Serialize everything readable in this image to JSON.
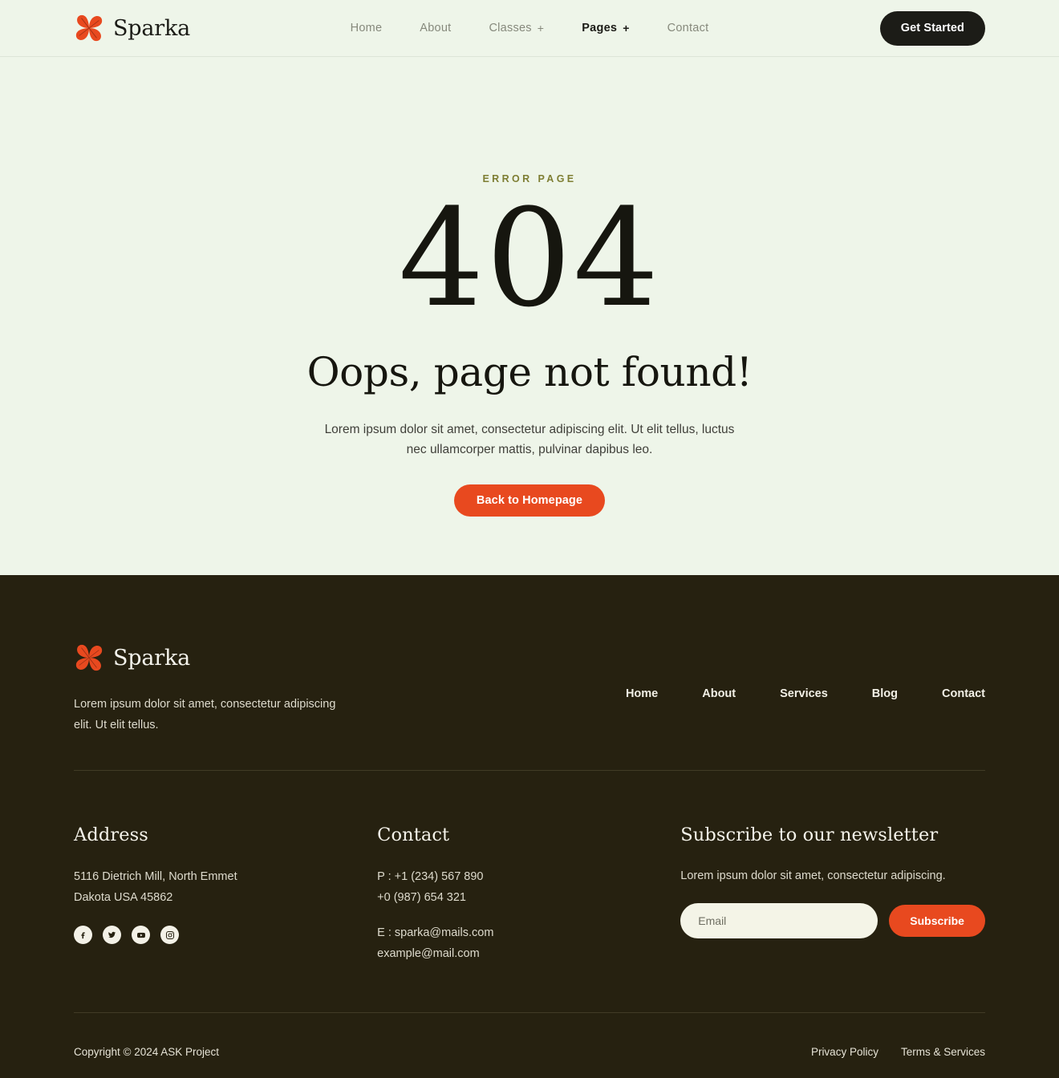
{
  "brand": {
    "name": "Sparka",
    "logo_icon": "four-petal-flower-icon",
    "accent_color": "#e8491f",
    "dark_color": "#262110",
    "hero_bg_color": "#eef5e9",
    "eyebrow_color": "#7e7e33"
  },
  "header": {
    "nav": [
      {
        "label": "Home",
        "has_dropdown": false,
        "active": false
      },
      {
        "label": "About",
        "has_dropdown": false,
        "active": false
      },
      {
        "label": "Classes",
        "has_dropdown": true,
        "plus": "+",
        "active": false
      },
      {
        "label": "Pages",
        "has_dropdown": true,
        "plus": "+",
        "active": true
      },
      {
        "label": "Contact",
        "has_dropdown": false,
        "active": false
      }
    ],
    "cta_label": "Get Started"
  },
  "hero": {
    "eyebrow": "ERROR PAGE",
    "code": "404",
    "title": "Oops, page not found!",
    "description": "Lorem ipsum dolor sit amet, consectetur adipiscing elit. Ut elit tellus, luctus nec ullamcorper mattis, pulvinar dapibus leo.",
    "button_label": "Back to Homepage"
  },
  "footer": {
    "about_text": "Lorem ipsum dolor sit amet, consectetur adipiscing elit. Ut elit tellus.",
    "nav": [
      {
        "label": "Home"
      },
      {
        "label": "About"
      },
      {
        "label": "Services"
      },
      {
        "label": "Blog"
      },
      {
        "label": "Contact"
      }
    ],
    "address": {
      "title": "Address",
      "line1": "5116 Dietrich Mill, North Emmet",
      "line2": "Dakota USA 45862"
    },
    "socials": [
      {
        "name": "facebook-icon",
        "label": "Facebook"
      },
      {
        "name": "twitter-icon",
        "label": "Twitter"
      },
      {
        "name": "youtube-icon",
        "label": "YouTube"
      },
      {
        "name": "instagram-icon",
        "label": "Instagram"
      }
    ],
    "contact": {
      "title": "Contact",
      "phone1": "P : +1 (234) 567 890",
      "phone2": "+0 (987) 654 321",
      "email1": "E : sparka@mails.com",
      "email2": "example@mail.com"
    },
    "newsletter": {
      "title": "Subscribe to our newsletter",
      "text": "Lorem ipsum dolor sit amet, consectetur adipiscing.",
      "input_placeholder": "Email",
      "input_value": "",
      "button_label": "Subscribe"
    },
    "bottom": {
      "copyright": "Copyright © 2024 ASK Project",
      "links": [
        {
          "label": "Privacy Policy"
        },
        {
          "label": "Terms & Services"
        }
      ]
    }
  }
}
